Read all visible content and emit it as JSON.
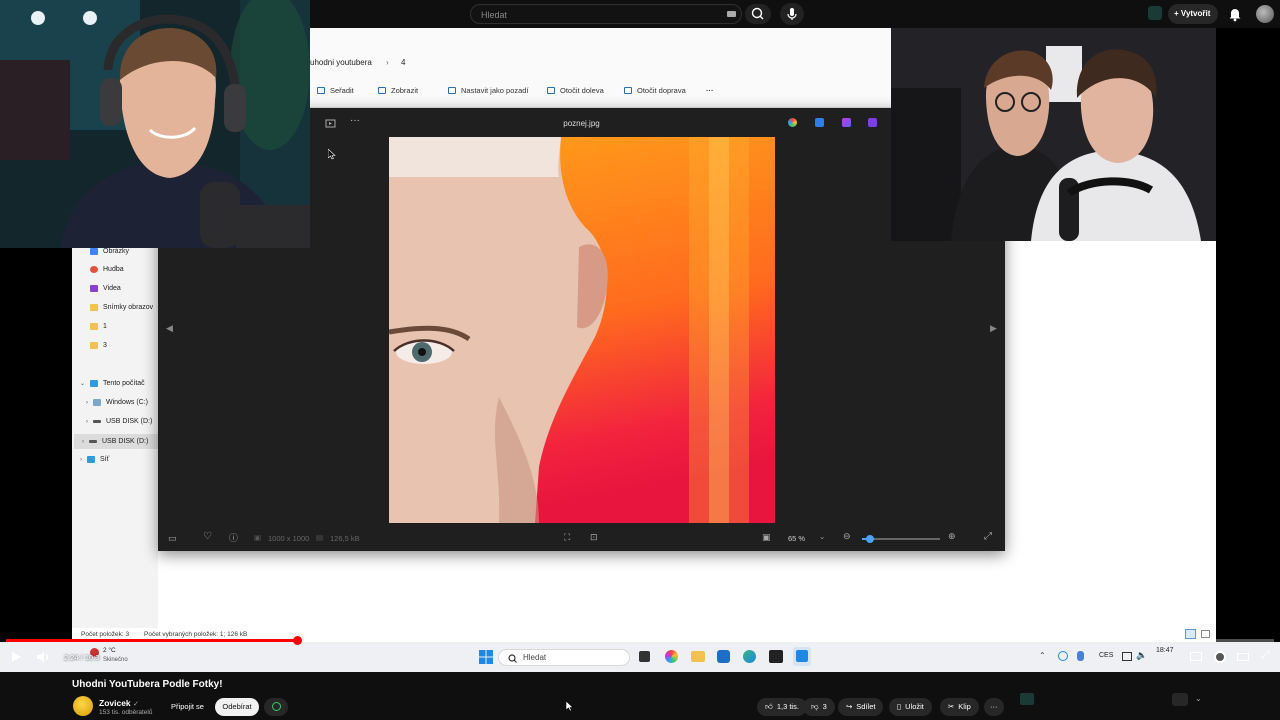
{
  "topbar": {
    "search_placeholder": "Hledat",
    "create_label": "Vytvořit"
  },
  "explorer": {
    "breadcrumb": [
      "uhodni youtubera",
      "4"
    ],
    "toolbar": [
      "Seřadit",
      "Zobrazit",
      "Nastavit jako pozadí",
      "Otočit doleva",
      "Otočit doprava"
    ],
    "nav_items": [
      "Obrázky",
      "Hudba",
      "Videa",
      "Snímky obrazov",
      "1",
      "3",
      "Tento počítač",
      "Windows (C:)",
      "USB DISK (D:)",
      "USB DISK (D:)",
      "Síť"
    ],
    "status_items": "Počet položek: 3",
    "status_selected": "Počet vybraných položek: 1; 126 kB"
  },
  "viewer": {
    "filename": "poznej.jpg",
    "dimensions": "1000 x 1000",
    "filesize": "126,5 kB",
    "zoom": "65 %",
    "zoom_level": 0.1
  },
  "taskbar": {
    "search_placeholder": "Hledat",
    "language": "CES",
    "time": "18:47",
    "weather_temp": "2 °C",
    "weather_desc": "Skinečno"
  },
  "player": {
    "current_time": "2:24",
    "duration": "10:3",
    "progress": 0.23
  },
  "video": {
    "title": "Uhodni YouTubera Podle Fotky!",
    "channel": "Zovicek",
    "subscribers": "153 tis. odběratelů",
    "join_label": "Připojit se",
    "subscribe_label": "Odebírat",
    "likes": "1,3 tis.",
    "dislikes": "3",
    "share_label": "Sdílet",
    "save_label": "Uložit",
    "clip_label": "Klip"
  },
  "colors": {
    "accent_red": "#ff0000",
    "viewer_bg": "#1f1f1f",
    "taskbar_bg": "#eef0f4"
  }
}
